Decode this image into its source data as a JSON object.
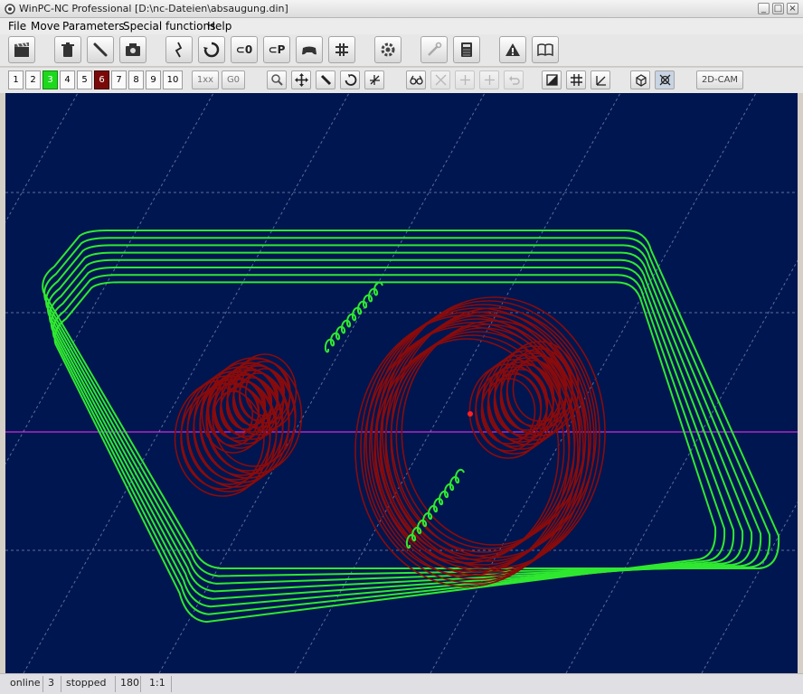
{
  "window": {
    "title": "WinPC-NC Professional [D:\\nc-Dateien\\absaugung.din]",
    "controls": [
      "_",
      "□",
      "×"
    ]
  },
  "menu": [
    "File",
    "Move",
    "Parameters",
    "Special functions",
    "Help"
  ],
  "toolbar_main": [
    {
      "name": "run-icon"
    },
    {
      "name": "trash-icon"
    },
    {
      "name": "pen-icon"
    },
    {
      "name": "camera-icon"
    },
    {
      "name": "path-icon"
    },
    {
      "name": "cycle-icon"
    },
    {
      "name": "zero-icon",
      "label": "⊂0"
    },
    {
      "name": "park-icon",
      "label": "⊂P"
    },
    {
      "name": "gamepad-icon"
    },
    {
      "name": "tool-change-icon"
    },
    {
      "name": "settings-icon"
    },
    {
      "name": "wrench-icon"
    },
    {
      "name": "calculator-icon"
    },
    {
      "name": "warning-icon"
    },
    {
      "name": "manual-icon"
    }
  ],
  "view_numbers": [
    "1",
    "2",
    "3",
    "4",
    "5",
    "6",
    "7",
    "8",
    "9",
    "10"
  ],
  "toolbar_view": {
    "btn_1xx": "1xx",
    "btn_g0": "G0",
    "btn_2dcam": "2D-CAM"
  },
  "status": {
    "connection": "online",
    "layer": "3",
    "state": "stopped",
    "value": "180",
    "scale": "1:1"
  },
  "colors": {
    "viewport_bg": "#001650",
    "toolpath_green": "#2fe830",
    "toolpath_red": "#8a0b0b",
    "axis_line": "#ff33ff",
    "position_marker": "#ff2020"
  }
}
